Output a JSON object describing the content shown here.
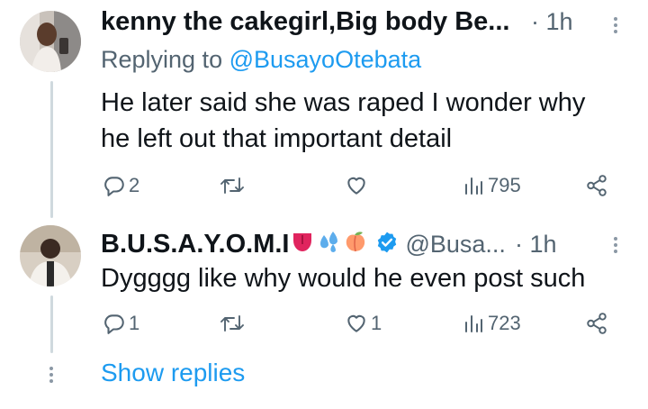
{
  "tweets": [
    {
      "author": "kenny the cakegirl,Big body Be...",
      "time_sep": "·",
      "time": "1h",
      "replying_prefix": "Replying to",
      "replying_handle": "@BusayoOtebata",
      "text_line1": "He later said she was raped I wonder why",
      "text_line2": "he left out that important detail",
      "replies": "2",
      "retweets": "",
      "likes": "",
      "views": "795"
    },
    {
      "author": "B.U.S.A.Y.O.M.I",
      "author_emojis": [
        "tongue-emoji",
        "sweat-droplets-emoji",
        "peach-emoji"
      ],
      "verified": true,
      "handle": "@Busa...",
      "time_sep": "·",
      "time": "1h",
      "text_line1": "Dygggg like why would he even post such",
      "replies": "1",
      "retweets": "",
      "likes": "1",
      "views": "723"
    }
  ],
  "show_replies_label": "Show replies",
  "colors": {
    "text": "#0f1419",
    "muted": "#536471",
    "accent": "#1d9bf0",
    "thread_line": "#cfd9de"
  }
}
